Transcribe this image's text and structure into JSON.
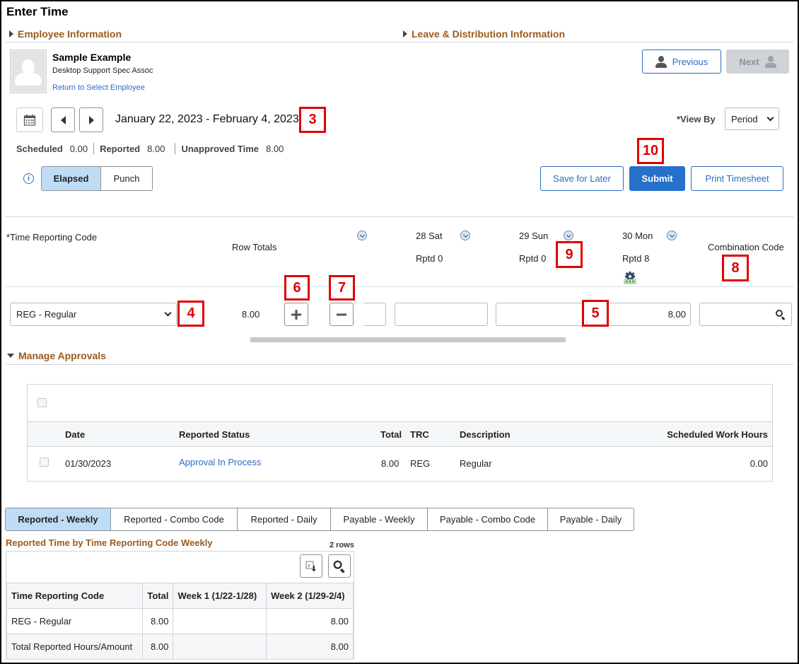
{
  "page": {
    "title": "Enter Time"
  },
  "sections": {
    "employee_info": "Employee Information",
    "leave_info": "Leave & Distribution Information",
    "manage_approvals": "Manage Approvals"
  },
  "employee": {
    "name": "Sample Example",
    "job_title": "Desktop Support Spec Assoc",
    "return_link": "Return to Select Employee"
  },
  "nav": {
    "previous_label": "Previous",
    "next_label": "Next"
  },
  "period": {
    "date_range": "January 22, 2023 - February 4, 2023"
  },
  "summary": {
    "scheduled_label": "Scheduled",
    "scheduled_value": "0.00",
    "reported_label": "Reported",
    "reported_value": "8.00",
    "unapproved_label": "Unapproved Time",
    "unapproved_value": "8.00"
  },
  "view_by": {
    "label": "*View By",
    "selected": "Period"
  },
  "mode_toggle": {
    "options": [
      "Elapsed",
      "Punch"
    ],
    "selected": "Elapsed"
  },
  "actions": {
    "save_label": "Save for Later",
    "submit_label": "Submit",
    "print_label": "Print Timesheet"
  },
  "timesheet": {
    "trc_header": "*Time Reporting Code",
    "row_totals_header": "Row Totals",
    "combo_header": "Combination Code",
    "days": [
      {
        "label": "28 Sat",
        "reported": "Rptd 0"
      },
      {
        "label": "29 Sun",
        "reported": "Rptd 0"
      },
      {
        "label": "30 Mon",
        "reported": "Rptd 8"
      }
    ],
    "row": {
      "trc_selected": "REG - Regular",
      "row_total": "8.00",
      "day_values": [
        "",
        "",
        "8.00"
      ],
      "combo_value": ""
    }
  },
  "annotations": [
    "3",
    "4",
    "5",
    "6",
    "7",
    "8",
    "9",
    "10"
  ],
  "approvals": {
    "columns": [
      "Date",
      "Reported Status",
      "Total",
      "TRC",
      "Description",
      "Scheduled Work Hours"
    ],
    "rows": [
      {
        "date": "01/30/2023",
        "status": "Approval In Process",
        "total": "8.00",
        "trc": "REG",
        "description": "Regular",
        "scheduled": "0.00"
      }
    ]
  },
  "summary_tabs": {
    "items": [
      "Reported - Weekly",
      "Reported - Combo Code",
      "Reported - Daily",
      "Payable - Weekly",
      "Payable - Combo Code",
      "Payable - Daily"
    ],
    "active": "Reported - Weekly"
  },
  "weekly_grid": {
    "title": "Reported Time by Time Reporting Code Weekly",
    "row_count": "2 rows",
    "columns": [
      "Time Reporting Code",
      "Total",
      "Week 1 (1/22-1/28)",
      "Week 2 (1/29-2/4)"
    ],
    "rows": [
      [
        "REG - Regular",
        "8.00",
        "",
        "8.00"
      ],
      [
        "Total Reported Hours/Amount",
        "8.00",
        "",
        "8.00"
      ]
    ]
  },
  "colors": {
    "accent": "#2670c9",
    "section_heading": "#9c5a1c",
    "annotation": "#e00000",
    "active_tab": "#bfdcf6"
  }
}
